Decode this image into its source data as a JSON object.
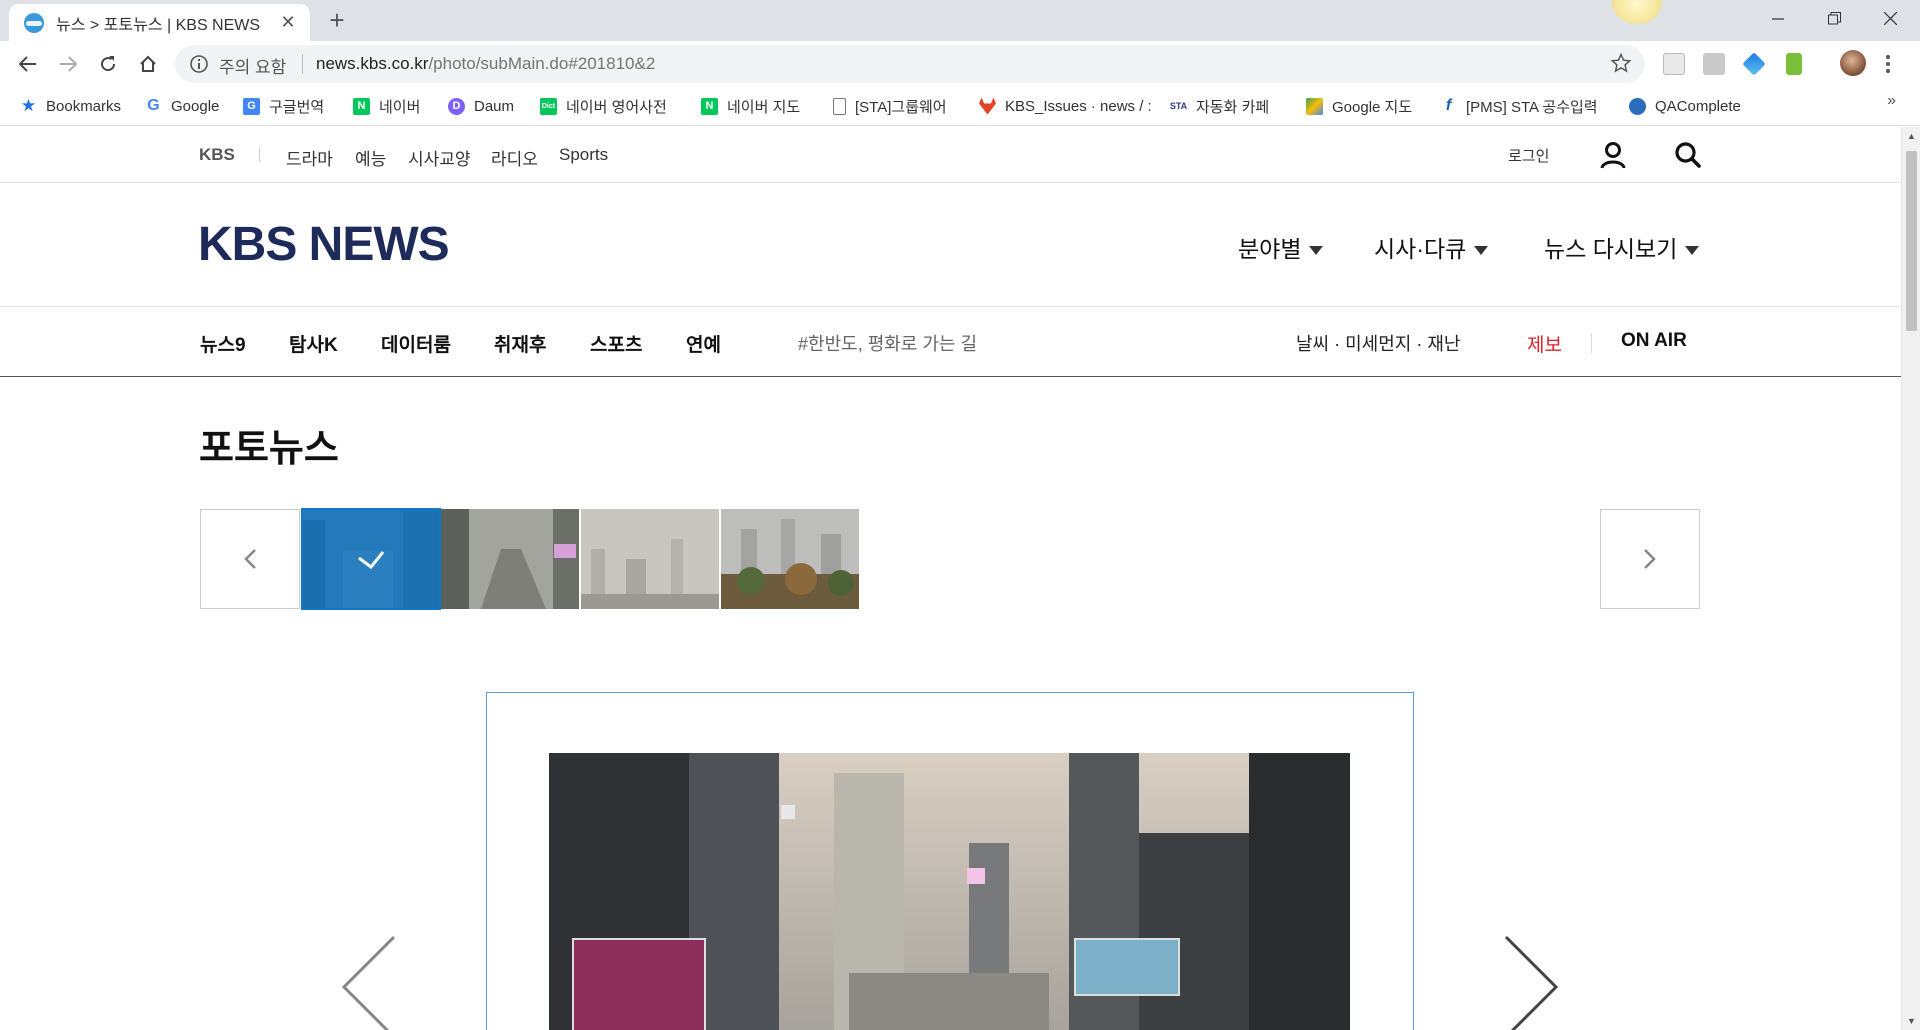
{
  "browser": {
    "tab_title": "뉴스 > 포토뉴스 | KBS NEWS",
    "tab_close": "✕",
    "new_tab": "+",
    "security_text": "주의 요함",
    "url_host": "news.kbs.co.kr",
    "url_path": "/photo/subMain.do#201810&2",
    "bookmarks": [
      {
        "label": "Bookmarks",
        "icon": "star-icon",
        "color": "#1a73e8"
      },
      {
        "label": "Google",
        "icon": "google-icon",
        "color": "#4285f4"
      },
      {
        "label": "구글번역",
        "icon": "translate-icon",
        "color": "#4285f4"
      },
      {
        "label": "네이버",
        "icon": "naver-icon",
        "color": "#03c75a"
      },
      {
        "label": "Daum",
        "icon": "daum-icon",
        "color": "#7b61ff"
      },
      {
        "label": "네이버 영어사전",
        "icon": "dict-icon",
        "color": "#03c75a"
      },
      {
        "label": "네이버 지도",
        "icon": "naver-icon",
        "color": "#03c75a"
      },
      {
        "label": "[STA]그룹웨어",
        "icon": "page-icon",
        "color": "#888888"
      },
      {
        "label": "KBS_Issues · news / :",
        "icon": "gitlab-icon",
        "color": "#e24329"
      },
      {
        "label": "자동화 카페",
        "icon": "cafe-icon",
        "color": "#2b3a8c"
      },
      {
        "label": "Google 지도",
        "icon": "maps-icon",
        "color": "#34a853"
      },
      {
        "label": "[PMS] STA 공수입력",
        "icon": "pms-icon",
        "color": "#1a5fb4"
      },
      {
        "label": "QAComplete",
        "icon": "qacomplete-icon",
        "color": "#2a6ebb"
      }
    ],
    "bookmarks_more": "»"
  },
  "site": {
    "util": {
      "brand": "KBS",
      "links": [
        "드라마",
        "예능",
        "시사교양",
        "라디오",
        "Sports"
      ],
      "login": "로그인"
    },
    "logo": "KBS NEWS",
    "menus": [
      "분야별",
      "시사·다큐",
      "뉴스 다시보기"
    ],
    "subnav": {
      "items": [
        "뉴스9",
        "탐사K",
        "데이터룸",
        "취재후",
        "스포츠",
        "연예"
      ],
      "tag": "#한반도, 평화로 가는 길",
      "weather": "날씨 · 미세먼지 · 재난",
      "report": "제보",
      "onair": "ON AIR"
    },
    "page_title": "포토뉴스",
    "accent_color": "#1277c5",
    "report_color": "#e0202a",
    "logo_color": "#1e2a5a"
  }
}
